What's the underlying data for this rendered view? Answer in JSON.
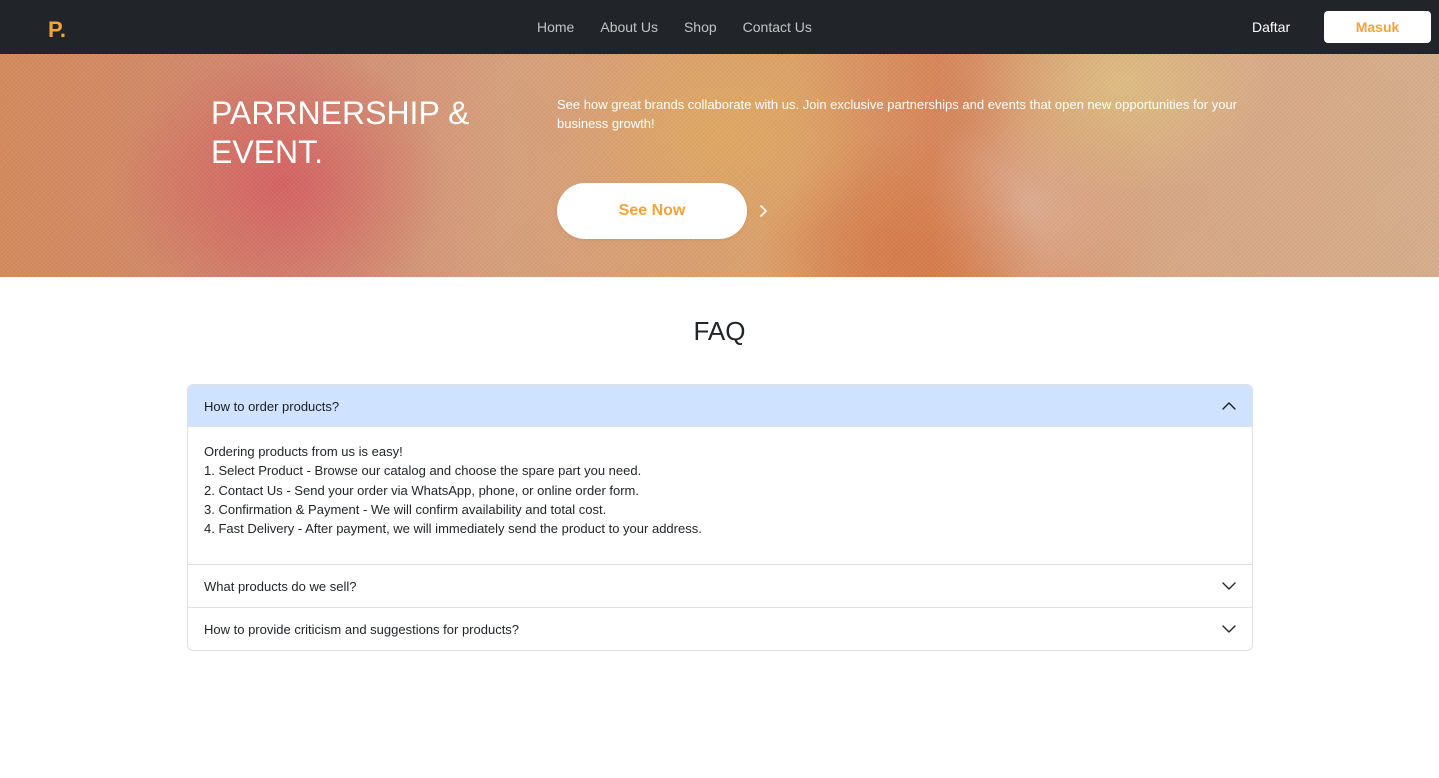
{
  "navbar": {
    "logo": "P.",
    "links": [
      "Home",
      "About Us",
      "Shop",
      "Contact Us"
    ],
    "register_label": "Daftar",
    "login_label": "Masuk"
  },
  "hero": {
    "title": "PARRNERSHIP & EVENT.",
    "description": "See how great brands collaborate with us. Join exclusive partnerships and events that open new opportunities for your business growth!",
    "cta_label": "See Now"
  },
  "faq": {
    "title": "FAQ",
    "items": [
      {
        "question": "How to order products?",
        "expanded": true,
        "answer": [
          "Ordering products from us is easy!",
          "1. Select Product - Browse our catalog and choose the spare part you need.",
          "2. Contact Us - Send your order via WhatsApp, phone, or online order form.",
          "3. Confirmation & Payment - We will confirm availability and total cost.",
          "4. Fast Delivery - After payment, we will immediately send the product to your address."
        ]
      },
      {
        "question": "What products do we sell?",
        "expanded": false
      },
      {
        "question": "How to provide criticism and suggestions for products?",
        "expanded": false
      }
    ]
  },
  "colors": {
    "navbar_bg": "#212529",
    "brand_accent": "#f2a33a",
    "accordion_active_bg": "#cfe2ff"
  },
  "icons": {
    "cta_arrow": "chevron-right-icon",
    "expanded": "chevron-up-icon",
    "collapsed": "chevron-down-icon"
  }
}
